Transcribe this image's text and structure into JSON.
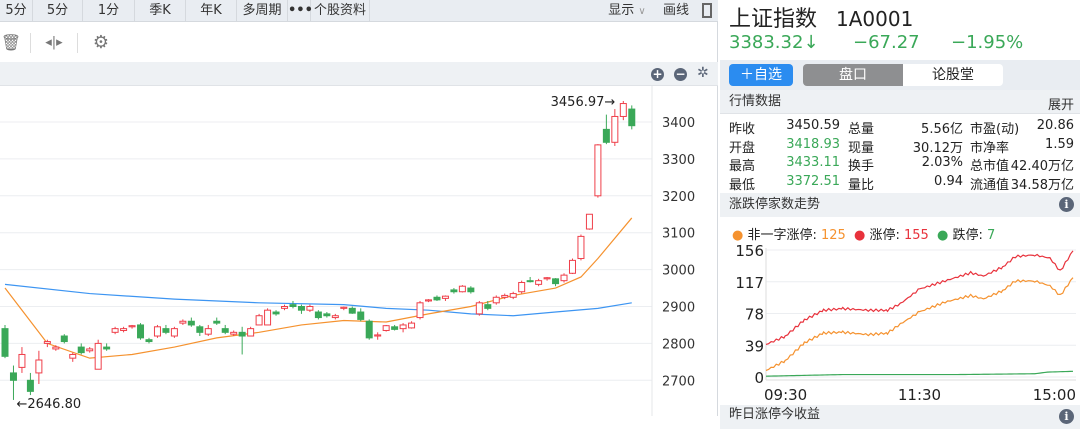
{
  "tabs": [
    "5分",
    "5分",
    "1分",
    "季K",
    "年K",
    "多周期",
    "•••",
    "个股资料"
  ],
  "tab_right": {
    "display": "显示",
    "draw": "画线"
  },
  "stock": {
    "name": "上证指数",
    "code": "1A0001",
    "price": "3383.32",
    "arrow": "↓",
    "change": "−67.27",
    "pct": "−1.95%"
  },
  "buttons": {
    "add": "＋自选",
    "pankou": "盘口",
    "lungu": "论股堂"
  },
  "quote": {
    "title": "行情数据",
    "expand": "展开",
    "rows": [
      [
        "昨收",
        "3450.59",
        "总量",
        "5.56亿",
        "市盈(动)",
        "20.86"
      ],
      [
        "开盘",
        "3418.93",
        "现量",
        "30.12万",
        "市净率",
        "1.59"
      ],
      [
        "最高",
        "3433.11",
        "换手",
        "2.03%",
        "总市值",
        "42.40万亿"
      ],
      [
        "最低",
        "3372.51",
        "量比",
        "0.94",
        "流通值",
        "34.58万亿"
      ]
    ]
  },
  "limit": {
    "title": "涨跌停家数走势",
    "legend": [
      {
        "label": "非一字涨停:",
        "value": "125",
        "color": "#f5922f"
      },
      {
        "label": "涨停:",
        "value": "155",
        "color": "#e8323c"
      },
      {
        "label": "跌停:",
        "value": "7",
        "color": "#3aa858"
      }
    ]
  },
  "bottom_section": {
    "title": "昨日涨停今收益"
  },
  "colors": {
    "up": "#ef3f4a",
    "down": "#3aa858",
    "ma_short": "#f5922f",
    "ma_long": "#3d95f2",
    "accent": "#2b8cf0"
  },
  "chart_data": [
    {
      "type": "candlestick",
      "title": "上证指数 K线",
      "yticks": [
        2700,
        2800,
        2900,
        3000,
        3100,
        3200,
        3300,
        3400
      ],
      "high_label": "3456.97",
      "low_label": "2646.80",
      "ohlc": [
        [
          2840,
          2850,
          2760,
          2765
        ],
        [
          2720,
          2740,
          2646.8,
          2700
        ],
        [
          2735,
          2790,
          2720,
          2770
        ],
        [
          2700,
          2720,
          2660,
          2670
        ],
        [
          2720,
          2780,
          2690,
          2755
        ],
        [
          2800,
          2810,
          2790,
          2805
        ],
        [
          2785,
          2795,
          2780,
          2790
        ],
        [
          2820,
          2825,
          2800,
          2805
        ],
        [
          2760,
          2775,
          2750,
          2770
        ],
        [
          2790,
          2800,
          2770,
          2775
        ],
        [
          2780,
          2790,
          2775,
          2785
        ],
        [
          2730,
          2810,
          2730,
          2800
        ],
        [
          2790,
          2800,
          2780,
          2785
        ],
        [
          2830,
          2845,
          2825,
          2840
        ],
        [
          2835,
          2845,
          2830,
          2840
        ],
        [
          2845,
          2850,
          2840,
          2848
        ],
        [
          2850,
          2855,
          2810,
          2815
        ],
        [
          2810,
          2815,
          2800,
          2805
        ],
        [
          2820,
          2850,
          2815,
          2845
        ],
        [
          2840,
          2850,
          2825,
          2830
        ],
        [
          2820,
          2845,
          2815,
          2840
        ],
        [
          2855,
          2865,
          2850,
          2860
        ],
        [
          2860,
          2870,
          2845,
          2850
        ],
        [
          2845,
          2850,
          2820,
          2830
        ],
        [
          2825,
          2850,
          2820,
          2840
        ],
        [
          2860,
          2870,
          2850,
          2855
        ],
        [
          2840,
          2850,
          2825,
          2830
        ],
        [
          2825,
          2835,
          2820,
          2830
        ],
        [
          2830,
          2845,
          2770,
          2820
        ],
        [
          2820,
          2845,
          2820,
          2840
        ],
        [
          2850,
          2880,
          2850,
          2875
        ],
        [
          2850,
          2895,
          2850,
          2890
        ],
        [
          2885,
          2890,
          2875,
          2880
        ],
        [
          2895,
          2905,
          2890,
          2900
        ],
        [
          2905,
          2915,
          2895,
          2900
        ],
        [
          2900,
          2905,
          2880,
          2890
        ],
        [
          2890,
          2905,
          2885,
          2900
        ],
        [
          2885,
          2890,
          2865,
          2870
        ],
        [
          2880,
          2885,
          2870,
          2875
        ],
        [
          2870,
          2880,
          2865,
          2875
        ],
        [
          2895,
          2900,
          2890,
          2898
        ],
        [
          2895,
          2900,
          2880,
          2882
        ],
        [
          2885,
          2895,
          2860,
          2865
        ],
        [
          2860,
          2865,
          2810,
          2815
        ],
        [
          2820,
          2830,
          2810,
          2823
        ],
        [
          2835,
          2850,
          2832,
          2848
        ],
        [
          2845,
          2850,
          2835,
          2838
        ],
        [
          2840,
          2855,
          2830,
          2850
        ],
        [
          2842,
          2860,
          2840,
          2855
        ],
        [
          2870,
          2915,
          2865,
          2910
        ],
        [
          2915,
          2920,
          2912,
          2918
        ],
        [
          2925,
          2930,
          2915,
          2918
        ],
        [
          2922,
          2930,
          2915,
          2928
        ],
        [
          2945,
          2950,
          2935,
          2940
        ],
        [
          2940,
          2958,
          2938,
          2955
        ],
        [
          2950,
          2955,
          2935,
          2940
        ],
        [
          2880,
          2915,
          2875,
          2910
        ],
        [
          2905,
          2915,
          2890,
          2895
        ],
        [
          2910,
          2930,
          2905,
          2925
        ],
        [
          2925,
          2935,
          2920,
          2930
        ],
        [
          2925,
          2940,
          2920,
          2935
        ],
        [
          2940,
          2970,
          2935,
          2965
        ],
        [
          2970,
          2980,
          2965,
          2968
        ],
        [
          2960,
          2975,
          2955,
          2970
        ],
        [
          2975,
          2980,
          2970,
          2978
        ],
        [
          2975,
          2977,
          2955,
          2962
        ],
        [
          2970,
          2990,
          2965,
          2985
        ],
        [
          2990,
          3030,
          2988,
          3025
        ],
        [
          3030,
          3095,
          3025,
          3090
        ],
        [
          3110,
          3150,
          3108,
          3150
        ],
        [
          3200,
          3340,
          3195,
          3338
        ],
        [
          3380,
          3420,
          3340,
          3345
        ],
        [
          3345,
          3435,
          3335,
          3415
        ],
        [
          3415,
          3456.97,
          3405,
          3450
        ],
        [
          3435,
          3445,
          3380,
          3390
        ]
      ],
      "ma_short": [
        [
          0,
          2950
        ],
        [
          5,
          2800
        ],
        [
          10,
          2760
        ],
        [
          15,
          2770
        ],
        [
          20,
          2790
        ],
        [
          25,
          2815
        ],
        [
          30,
          2830
        ],
        [
          35,
          2850
        ],
        [
          40,
          2862
        ],
        [
          45,
          2858
        ],
        [
          50,
          2880
        ],
        [
          55,
          2900
        ],
        [
          60,
          2930
        ],
        [
          65,
          2950
        ],
        [
          68,
          2980
        ],
        [
          70,
          3030
        ],
        [
          74,
          3140
        ]
      ],
      "ma_long": [
        [
          0,
          2960
        ],
        [
          10,
          2935
        ],
        [
          20,
          2920
        ],
        [
          30,
          2910
        ],
        [
          40,
          2905
        ],
        [
          45,
          2895
        ],
        [
          50,
          2890
        ],
        [
          55,
          2880
        ],
        [
          60,
          2875
        ],
        [
          65,
          2885
        ],
        [
          70,
          2895
        ],
        [
          74,
          2910
        ]
      ]
    },
    {
      "type": "line",
      "title": "涨跌停家数走势",
      "yticks": [
        0,
        39,
        78,
        117,
        156
      ],
      "xticks": [
        "09:30",
        "11:30",
        "15:00"
      ],
      "ylim": [
        0,
        156
      ],
      "series": [
        {
          "name": "涨停",
          "color": "#e8323c",
          "points": [
            [
              0,
              40
            ],
            [
              15,
              50
            ],
            [
              30,
              70
            ],
            [
              45,
              82
            ],
            [
              60,
              84
            ],
            [
              80,
              82
            ],
            [
              95,
              82
            ],
            [
              105,
              90
            ],
            [
              120,
              108
            ],
            [
              140,
              118
            ],
            [
              160,
              128
            ],
            [
              170,
              124
            ],
            [
              185,
              135
            ],
            [
              195,
              148
            ],
            [
              210,
              150
            ],
            [
              222,
              146
            ],
            [
              230,
              130
            ],
            [
              240,
              155
            ]
          ]
        },
        {
          "name": "非一字涨停",
          "color": "#f5922f",
          "points": [
            [
              0,
              8
            ],
            [
              15,
              20
            ],
            [
              30,
              42
            ],
            [
              45,
              54
            ],
            [
              60,
              55
            ],
            [
              80,
              52
            ],
            [
              95,
              54
            ],
            [
              105,
              65
            ],
            [
              120,
              80
            ],
            [
              140,
              92
            ],
            [
              160,
              100
            ],
            [
              170,
              96
            ],
            [
              185,
              106
            ],
            [
              195,
              118
            ],
            [
              210,
              118
            ],
            [
              222,
              112
            ],
            [
              230,
              100
            ],
            [
              240,
              122
            ]
          ]
        },
        {
          "name": "跌停",
          "color": "#3aa858",
          "points": [
            [
              0,
              1
            ],
            [
              60,
              3
            ],
            [
              150,
              3
            ],
            [
              210,
              4
            ],
            [
              220,
              6
            ],
            [
              240,
              7
            ]
          ]
        }
      ]
    }
  ]
}
